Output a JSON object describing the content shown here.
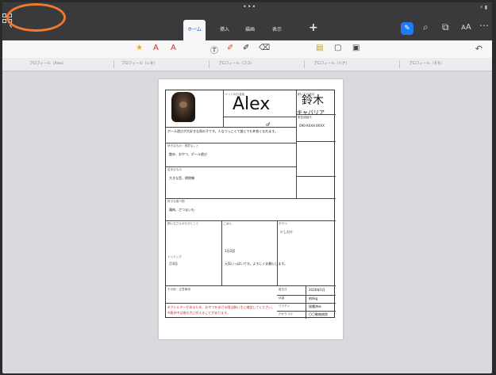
{
  "statusbar": {
    "time": "",
    "center": "•••",
    "right": "⚡ ▮"
  },
  "appbar": {
    "tabs": [
      {
        "label": "ホーム",
        "active": true
      },
      {
        "label": "挿入",
        "active": false
      },
      {
        "label": "描画",
        "active": false
      },
      {
        "label": "表示",
        "active": false
      }
    ],
    "plus": "+"
  },
  "document_tabs": [
    "プロフィール（Alex）",
    "プロフィール（レオ）",
    "プロフィール（ココ）",
    "プロフィール（ハナ）",
    "プロフィール（モモ）"
  ],
  "sheet": {
    "name_caption": "ペットのお名前",
    "name": "Alex",
    "surname_caption": "飼い主の苗字",
    "surname": "鈴木",
    "breed": "キャバリア",
    "sex_symbol": "♂",
    "intro": "ボール遊びが大好きな男の子です。人なつっこくて誰とでも仲良くなれます。",
    "favorites_caption": "好きなもの・得意なこと",
    "favorites": "散歩、おやつ、ボール遊び",
    "dislikes_caption": "苦手なもの",
    "dislikes": "大きな音、掃除機",
    "food_caption": "好きな食べ物",
    "food": "鶏肉、さつまいも",
    "notes_caption": "飼い主さんからひとこと",
    "notes": "元気いっぱいです。よろしくお願いします。",
    "m1_caption": "ごはん",
    "m1_value": "1日2回",
    "m2_caption": "おやつ",
    "m2_value": "少しだけ",
    "m3_caption": "トリミング",
    "m3_value": "月1回",
    "contact_caption": "緊急連絡先",
    "contact": "090-XXXX-XXXX",
    "rows": [
      {
        "caption": "誕生日",
        "value": "2020年5月"
      },
      {
        "caption": "体重",
        "value": "約6kg"
      },
      {
        "caption": "ワクチン",
        "value": "接種済み"
      },
      {
        "caption": "かかりつけ",
        "value": "〇〇動物病院"
      }
    ],
    "remark_caption": "その他・注意事項",
    "remarks": [
      "※アレルギーがあるため、おやつをあげる際は飼い主に確認してください。",
      "※散歩中は他の犬に吠えることがあります。"
    ]
  }
}
